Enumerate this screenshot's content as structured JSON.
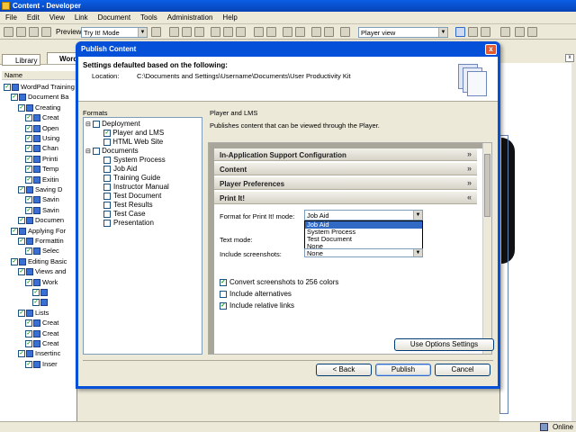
{
  "window": {
    "title": "Content - Developer"
  },
  "menu": [
    "File",
    "Edit",
    "View",
    "Link",
    "Document",
    "Tools",
    "Administration",
    "Help"
  ],
  "toolbar": {
    "preview_label": "Preview:",
    "preview_mode": "Try It! Mode",
    "view_mode": "Player view"
  },
  "left_tabs": {
    "library": "Library",
    "word": "Word"
  },
  "tree": {
    "column_name": "Name",
    "rows": [
      "WordPad Training",
      "Document Ba",
      "Creating",
      "Creat",
      "Open",
      "Using",
      "Chan",
      "Printi",
      "Temp",
      "Exitin",
      "Saving D",
      "Savin",
      "Savin",
      "Documen",
      "Applying For",
      "Formattin",
      "Selec",
      "Editing Basic",
      "Views and",
      "Work",
      "",
      "",
      "Lists",
      "Creat",
      "Creat",
      "Creat",
      "Insertinc",
      "Inser"
    ]
  },
  "status": {
    "online": "Online"
  },
  "dialog": {
    "title": "Publish Content",
    "close": "x",
    "header_title": "Settings defaulted based on the following:",
    "location_label": "Location:",
    "location_value": "C:\\Documents and Settings\\Username\\Documents\\User Productivity Kit",
    "formats_label": "Formats",
    "formats": {
      "deployment": "Deployment",
      "player_lms": "Player and LMS",
      "html_web": "HTML Web Site",
      "documents": "Documents",
      "docs": [
        "System Process",
        "Job Aid",
        "Training Guide",
        "Instructor Manual",
        "Test Document",
        "Test Results",
        "Test Case",
        "Presentation"
      ]
    },
    "right_title": "Player and LMS",
    "right_desc": "Publishes content that can be viewed through the Player.",
    "sections": {
      "inapp": "In-Application Support Configuration",
      "content": "Content",
      "player_prefs": "Player Preferences",
      "printit": "Print It!"
    },
    "printit": {
      "format_label": "Format for Print It! mode:",
      "format_value": "Job Aid",
      "format_options": [
        "Job Aid",
        "System Process",
        "Test Document",
        "None"
      ],
      "text_mode_label": "Text mode:",
      "screenshots_label": "Include screenshots:",
      "screenshots_value": "None",
      "convert_label": "Convert screenshots to 256 colors",
      "alternatives_label": "Include alternatives",
      "relative_links_label": "Include relative links"
    },
    "buttons": {
      "options": "Use Options Settings",
      "back": "< Back",
      "publish": "Publish",
      "cancel": "Cancel"
    }
  }
}
